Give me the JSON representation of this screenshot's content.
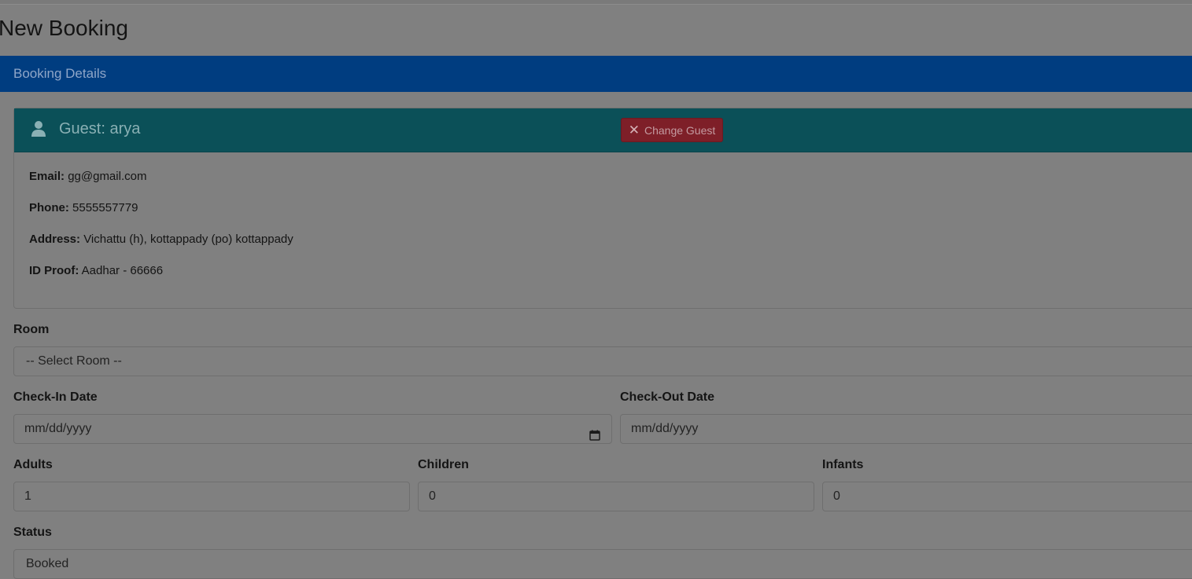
{
  "page": {
    "title": "New Booking"
  },
  "booking_details": {
    "header": "Booking Details"
  },
  "guest": {
    "title": "Guest: arya",
    "change_button": "Change Guest",
    "email_label": "Email:",
    "email": "gg@gmail.com",
    "phone_label": "Phone:",
    "phone": "5555557779",
    "address_label": "Address:",
    "address": "Vichattu (h), kottappady (po) kottappady",
    "idproof_label": "ID Proof:",
    "idproof": "Aadhar - 66666"
  },
  "form": {
    "room_label": "Room",
    "room_value": "-- Select Room --",
    "checkin_label": "Check-In Date",
    "checkin_value": "mm/dd/yyyy",
    "checkout_label": "Check-Out Date",
    "checkout_value": "mm/dd/yyyy",
    "adults_label": "Adults",
    "adults_value": "1",
    "children_label": "Children",
    "children_value": "0",
    "infants_label": "Infants",
    "infants_value": "0",
    "status_label": "Status",
    "status_value": "Booked"
  },
  "colors": {
    "overlay": "#808080",
    "primary_header": "#003d80",
    "guest_header": "#0b5058",
    "danger_button": "#7e1f28"
  },
  "icons": {
    "guest": "user-icon",
    "change": "close-icon",
    "date": "calendar-icon"
  }
}
